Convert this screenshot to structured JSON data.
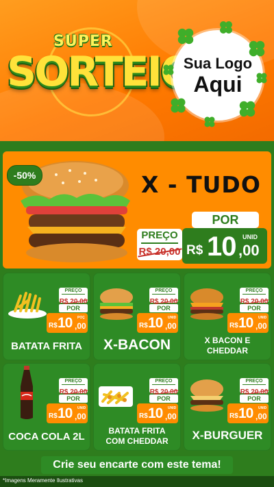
{
  "header": {
    "super_word": "SUPER",
    "main_word": "SORTEIO",
    "logo_line1": "Sua Logo",
    "logo_line2": "Aqui"
  },
  "hero": {
    "discount": "-50%",
    "title": "X - TUDO",
    "por_label": "POR",
    "preco_label": "PREÇO",
    "old_price": "R$ 20,00",
    "currency": "R$",
    "price_int": "10",
    "price_dec": ",00",
    "unit": "UNID"
  },
  "cards": [
    {
      "name": "BATATA FRITA",
      "preco_label": "PREÇO",
      "old_price": "R$ 20,00",
      "por": "POR",
      "currency": "R$",
      "price_int": "10",
      "price_dec": ",00",
      "unit": "POÇ"
    },
    {
      "name": "X-BACON",
      "preco_label": "PREÇO",
      "old_price": "R$ 20,00",
      "por": "POR",
      "currency": "R$",
      "price_int": "10",
      "price_dec": ",00",
      "unit": "UNID"
    },
    {
      "name_line1": "X BACON E",
      "name_line2": "CHEDDAR",
      "preco_label": "PREÇO",
      "old_price": "R$ 20,00",
      "por": "POR",
      "currency": "R$",
      "price_int": "10",
      "price_dec": ",00",
      "unit": "UNID"
    },
    {
      "name": "COCA COLA 2L",
      "preco_label": "PREÇO",
      "old_price": "R$ 20,00",
      "por": "POR",
      "currency": "R$",
      "price_int": "10",
      "price_dec": ",00",
      "unit": "UNID"
    },
    {
      "name_line1": "BATATA FRITA",
      "name_line2": "COM CHEDDAR",
      "preco_label": "PREÇO",
      "old_price": "R$ 20,00",
      "por": "POR",
      "currency": "R$",
      "price_int": "10",
      "price_dec": ",00",
      "unit": "UNID"
    },
    {
      "name": "X-BURGUER",
      "preco_label": "PREÇO",
      "old_price": "R$ 20,00",
      "por": "POR",
      "currency": "R$",
      "price_int": "10",
      "price_dec": ",00",
      "unit": "UNID"
    }
  ],
  "cta": "Crie seu encarte com este tema!",
  "footer_note": "*Imagens Meramente Ilustrativas",
  "colors": {
    "orange": "#ff8c00",
    "green": "#2e8b25",
    "dark_green": "#2e7d1d",
    "strike_red": "#c8302a"
  }
}
